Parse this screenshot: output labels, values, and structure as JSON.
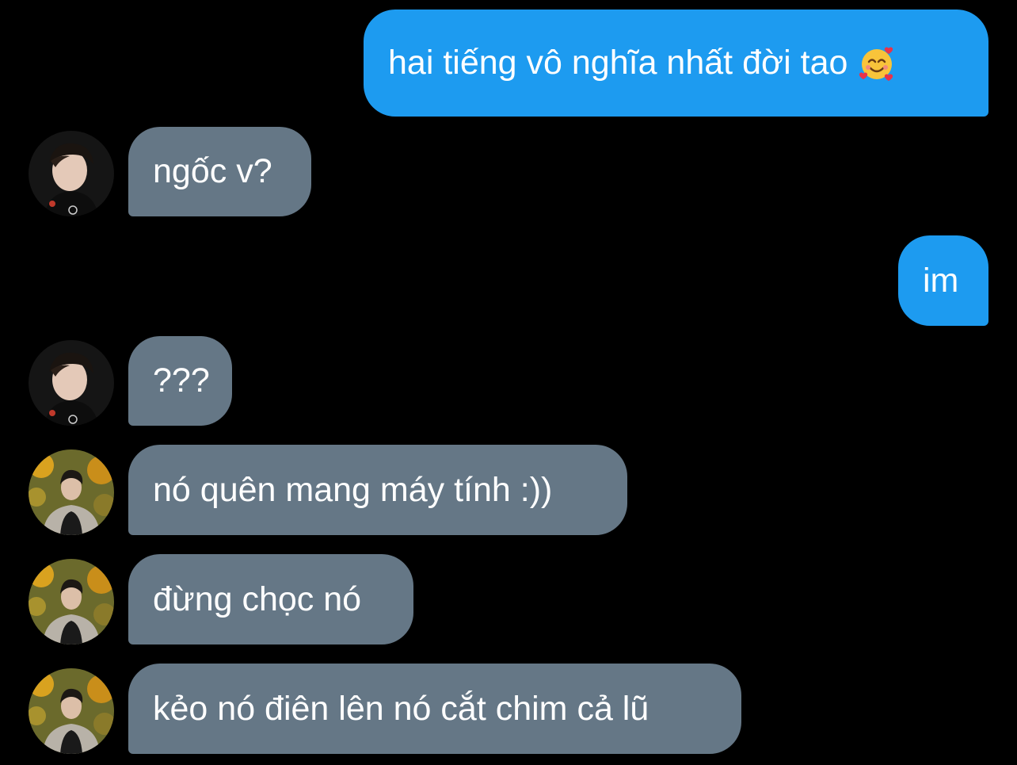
{
  "colors": {
    "background": "#000000",
    "sent_bubble": "#1d9bf0",
    "received_bubble": "#657786",
    "text": "#ffffff"
  },
  "messages": [
    {
      "side": "sent",
      "text": "hai tiếng vô nghĩa nhất đời tao",
      "emoji": "smiling-face-with-hearts"
    },
    {
      "side": "received",
      "sender_avatar": "avatar-user-a",
      "text": "ngốc v?"
    },
    {
      "side": "sent",
      "text": "im"
    },
    {
      "side": "received",
      "sender_avatar": "avatar-user-a",
      "text": "???"
    },
    {
      "side": "received",
      "sender_avatar": "avatar-user-b",
      "text": "nó quên mang máy tính :))"
    },
    {
      "side": "received",
      "sender_avatar": "avatar-user-b",
      "text": "đừng chọc nó"
    },
    {
      "side": "received",
      "sender_avatar": "avatar-user-b",
      "text": "kẻo nó điên lên nó cắt chim cả lũ"
    }
  ]
}
